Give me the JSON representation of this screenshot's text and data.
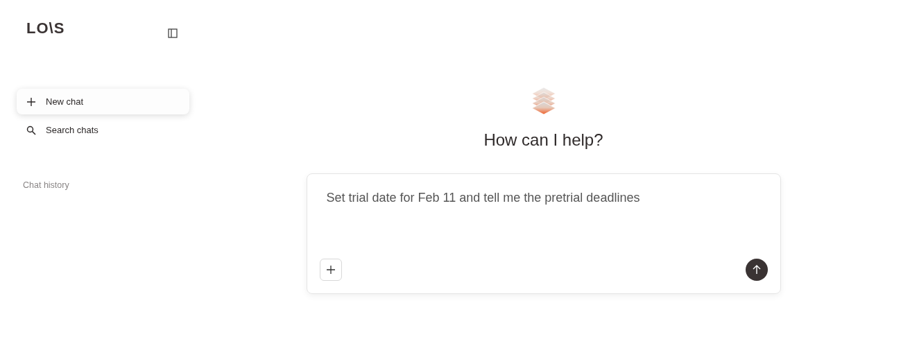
{
  "sidebar": {
    "logo": "LO\\S",
    "items": [
      {
        "kind": "new",
        "label": "New chat",
        "selected": true
      },
      {
        "kind": "search",
        "label": "Search chats",
        "selected": false
      }
    ],
    "section_label": "Chat history"
  },
  "main": {
    "heading": "How can I help?",
    "composer": {
      "value": "Set trial date for Feb 11 and tell me the pretrial deadlines "
    }
  }
}
